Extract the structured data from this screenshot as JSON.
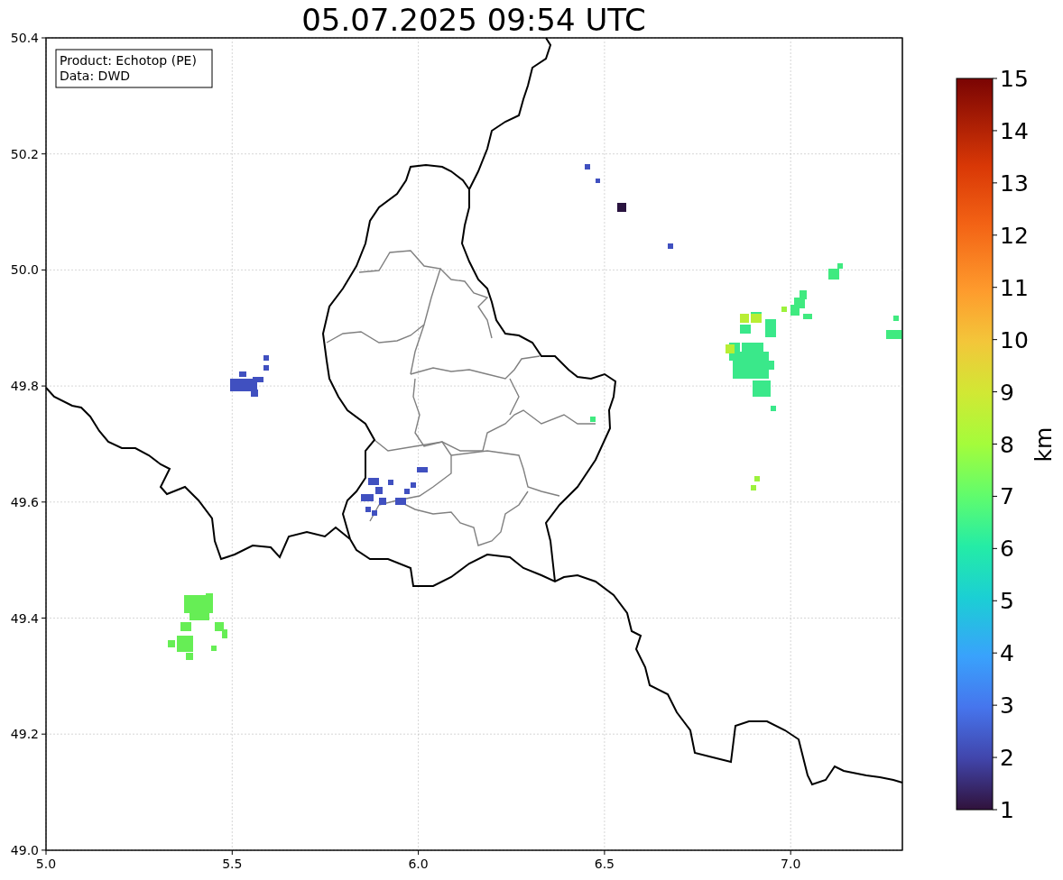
{
  "title": "05.07.2025 09:54 UTC",
  "info_box": [
    "Product: Echotop (PE)",
    "Data: DWD"
  ],
  "map": {
    "xticks": [
      "5.0",
      "5.5",
      "6.0",
      "6.5",
      "7.0"
    ],
    "yticks": [
      "50.4",
      "50.2",
      "50.0",
      "49.8",
      "49.6",
      "49.4",
      "49.2",
      "49.0"
    ]
  },
  "colorbar": {
    "label": "km",
    "ticks": [
      "15",
      "14",
      "13",
      "12",
      "11",
      "10",
      "9",
      "8",
      "7",
      "6",
      "5",
      "4",
      "3",
      "2",
      "1"
    ]
  }
}
